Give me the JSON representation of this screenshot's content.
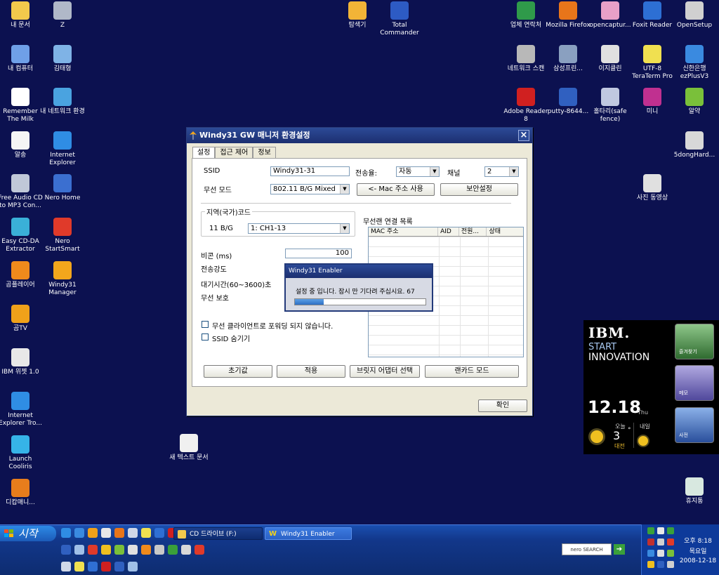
{
  "desktop": {
    "left_icons": [
      {
        "label": "내 문서",
        "icon": "folder-icon",
        "color": "#f2c94c"
      },
      {
        "label": "Z",
        "icon": "network-drive-icon",
        "color": "#b0b8c8"
      },
      {
        "label": "내 컴퓨터",
        "icon": "computer-icon",
        "color": "#6fa0e8"
      },
      {
        "label": "김태형",
        "icon": "folder-icon",
        "color": "#7fb3e6"
      },
      {
        "label": "Remember The Milk",
        "icon": "cow-icon",
        "color": "#ffffff"
      },
      {
        "label": "내 네트워크 환경",
        "icon": "network-icon",
        "color": "#4aa3e0"
      },
      {
        "label": "알송",
        "icon": "music-icon",
        "color": "#f5f5f5"
      },
      {
        "label": "Internet Explorer",
        "icon": "ie-icon",
        "color": "#2f8de4"
      },
      {
        "label": "Free Audio CD to MP3 Con...",
        "icon": "cd-icon",
        "color": "#c0c8d8"
      },
      {
        "label": "Nero Home",
        "icon": "nero-home-icon",
        "color": "#3b6fd0"
      },
      {
        "label": "Easy CD-DA Extractor",
        "icon": "cd-extract-icon",
        "color": "#3ab0d8"
      },
      {
        "label": "Nero StartSmart",
        "icon": "nero-icon",
        "color": "#e03a2a"
      },
      {
        "label": "곰플레이어",
        "icon": "gom-player-icon",
        "color": "#f08a1c"
      },
      {
        "label": "Windy31 Manager",
        "icon": "windy-icon",
        "color": "#f3a61c"
      },
      {
        "label": "곰TV",
        "icon": "gom-tv-icon",
        "color": "#f0a11a"
      },
      {
        "label": "IBM 위젯 1.0",
        "icon": "ibm-widget-icon",
        "color": "#e8e8e8"
      },
      {
        "label": "Internet Explorer Tro...",
        "icon": "ie-shortcut-icon",
        "color": "#2f8de4"
      },
      {
        "label": "Launch Cooliris",
        "icon": "cooliris-icon",
        "color": "#36b3e8"
      },
      {
        "label": "디캅매니...",
        "icon": "dicap-icon",
        "color": "#e87d1c"
      }
    ],
    "top_icons": [
      {
        "label": "탐색기",
        "icon": "explorer-icon",
        "color": "#f2b437"
      },
      {
        "label": "Total Commander",
        "icon": "floppy-icon",
        "color": "#2d5bc4"
      }
    ],
    "right_icons": [
      {
        "label": "업체 연락처",
        "icon": "excel-icon",
        "color": "#2f9a4a"
      },
      {
        "label": "Mozilla Firefox",
        "icon": "firefox-icon",
        "color": "#e8751a"
      },
      {
        "label": "opencaptur...",
        "icon": "gift-icon",
        "color": "#e8a0c8"
      },
      {
        "label": "Foxit Reader",
        "icon": "foxit-icon",
        "color": "#2d6fd4"
      },
      {
        "label": "OpenSetup",
        "icon": "opensetup-icon",
        "color": "#d0d0d0"
      },
      {
        "label": "네트워크 스캔",
        "icon": "scanner-icon",
        "color": "#b8b8b8"
      },
      {
        "label": "삼성프린...",
        "icon": "printer-icon",
        "color": "#8aa0c0"
      },
      {
        "label": "이지클린",
        "icon": "easyclean-icon",
        "color": "#e0e0e0"
      },
      {
        "label": "UTF-8 TeraTerm Pro",
        "icon": "teraterm-icon",
        "color": "#f0e050"
      },
      {
        "label": "신한은행 ezPlusV3",
        "icon": "bank-icon",
        "color": "#3a8ae0"
      },
      {
        "label": "Adobe Reader 8",
        "icon": "pdf-icon",
        "color": "#d02020"
      },
      {
        "label": "putty-8644...",
        "icon": "putty-icon",
        "color": "#3060c0"
      },
      {
        "label": "홀타리(safe fence)",
        "icon": "magnifier-icon",
        "color": "#c0c8e0"
      },
      {
        "label": "미니",
        "icon": "mini-icon",
        "color": "#c03090"
      },
      {
        "label": "알약",
        "icon": "alyac-icon",
        "color": "#7ac03a"
      },
      {
        "label": "5dongHard...",
        "icon": "harddisk-icon",
        "color": "#d8d8d8"
      },
      {
        "label": "사진 동영상",
        "icon": "camera-icon",
        "color": "#e0e0e0"
      },
      {
        "label": "새 텍스트 문서",
        "icon": "text-file-icon",
        "color": "#f0f0f0"
      },
      {
        "label": "휴지통",
        "icon": "recycle-bin-icon",
        "color": "#d8e8e0"
      }
    ]
  },
  "window": {
    "title": "Windy31 GW 매니저 환경설정",
    "tabs": [
      "설정",
      "접근 제어",
      "정보"
    ],
    "ssid_label": "SSID",
    "ssid_value": "Windy31-31",
    "rate_label": "전송율:",
    "rate_value": "자동",
    "channel_label": "채널",
    "channel_value": "2",
    "mode_label": "무선 모드",
    "mode_value": "802.11 B/G Mixed",
    "mac_button": "<- Mac 주소 사용",
    "security_button": "보안설정",
    "region_label": "지역(국가)코드",
    "region_band": "11 B/G",
    "region_value": "1: CH1-13",
    "beacon_label": "비콘 (ms)",
    "beacon_value": "100",
    "power_label": "전송강도",
    "timeout_label": "대기시간(60~3600)초",
    "protect_label": "무선 보호",
    "client_list_label": "무선랜 연결 목록",
    "list_columns": [
      "MAC 주소",
      "AID",
      "전원...",
      "상태"
    ],
    "no_forward_label": "무선 클라이언트로 포워딩 되지 않습니다.",
    "hide_ssid_label": "SSID 숨기기",
    "default_button": "초기값",
    "apply_button": "적용",
    "bridge_button": "브릿지 어댑터 선택",
    "lancard_button": "랜카드 모드",
    "ok_button": "확인"
  },
  "popup": {
    "title": "Windy31 Enabler",
    "message": "설정 중 입니다. 잠시 만 기다려 주십시요. 67",
    "progress": 0.22
  },
  "taskbar": {
    "start_label": "시작",
    "tasks": [
      {
        "label": "CD 드라이브 (F:)",
        "icon": "folder-icon"
      },
      {
        "label": "Windy31 Enabler",
        "icon": "windy-w-icon"
      }
    ],
    "nero_label": "nero SEARCH",
    "time": "오후 8:18",
    "day": "목요일",
    "date": "2008-12-18"
  },
  "ibm_widget": {
    "brand": "IBM.",
    "line1": "START",
    "line2": "INNOVATION",
    "date_big": "12.18",
    "weekday": "Thu",
    "today_label": "오늘",
    "today_temp": "3",
    "degree": "°",
    "city": "대전",
    "tomorrow_label": "내일",
    "tile1": "즐겨찾기",
    "tile2": "메모",
    "tile3": "사전"
  }
}
